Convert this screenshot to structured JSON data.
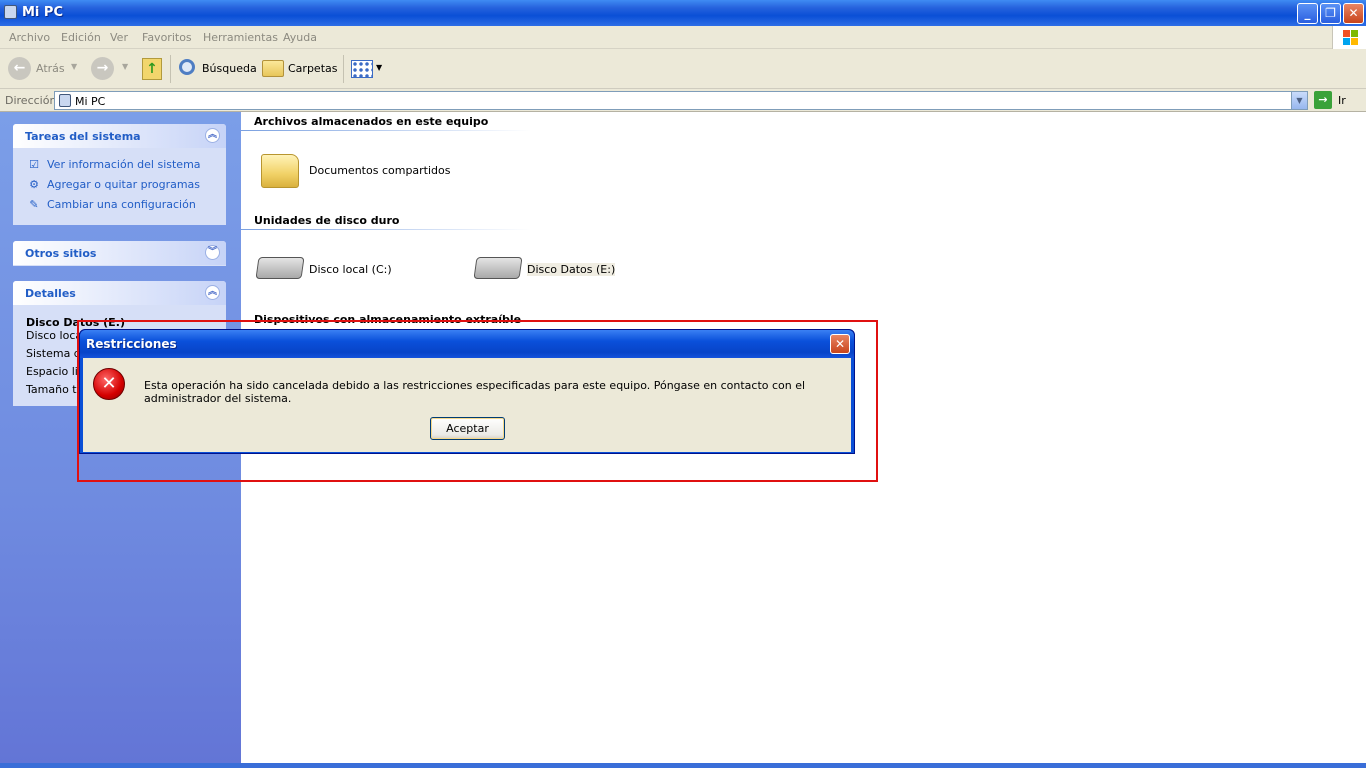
{
  "window": {
    "title": "Mi PC"
  },
  "menu": [
    "Archivo",
    "Edición",
    "Ver",
    "Favoritos",
    "Herramientas",
    "Ayuda"
  ],
  "toolbar": {
    "back_label": "Atrás",
    "search_label": "Búsqueda",
    "folders_label": "Carpetas"
  },
  "address": {
    "label": "Dirección",
    "value": "Mi PC",
    "go_label": "Ir"
  },
  "sidebar": {
    "system_tasks": {
      "title": "Tareas del sistema",
      "items": [
        "Ver información del sistema",
        "Agregar o quitar programas",
        "Cambiar una configuración"
      ]
    },
    "other_places": {
      "title": "Otros sitios"
    },
    "details": {
      "title": "Detalles",
      "name": "Disco Datos (E:)",
      "lines": [
        "Disco local",
        "Sistema de",
        "Espacio libr",
        "Tamaño to"
      ]
    }
  },
  "main": {
    "sections": [
      {
        "title": "Archivos almacenados en este equipo",
        "items": [
          "Documentos compartidos"
        ]
      },
      {
        "title": "Unidades de disco duro",
        "items": [
          "Disco local (C:)",
          "Disco Datos (E:)"
        ]
      },
      {
        "title": "Dispositivos con almacenamiento extraíble",
        "items": []
      }
    ]
  },
  "dialog": {
    "title": "Restricciones",
    "message": "Esta operación ha sido cancelada debido a las restricciones especificadas para este equipo. Póngase en contacto con el administrador del sistema.",
    "ok_label": "Aceptar"
  },
  "colors": {
    "titlebar": "#0a4fd6",
    "sidebar": "#6f8be0",
    "link": "#215dc6",
    "highlight": "#e01010"
  }
}
